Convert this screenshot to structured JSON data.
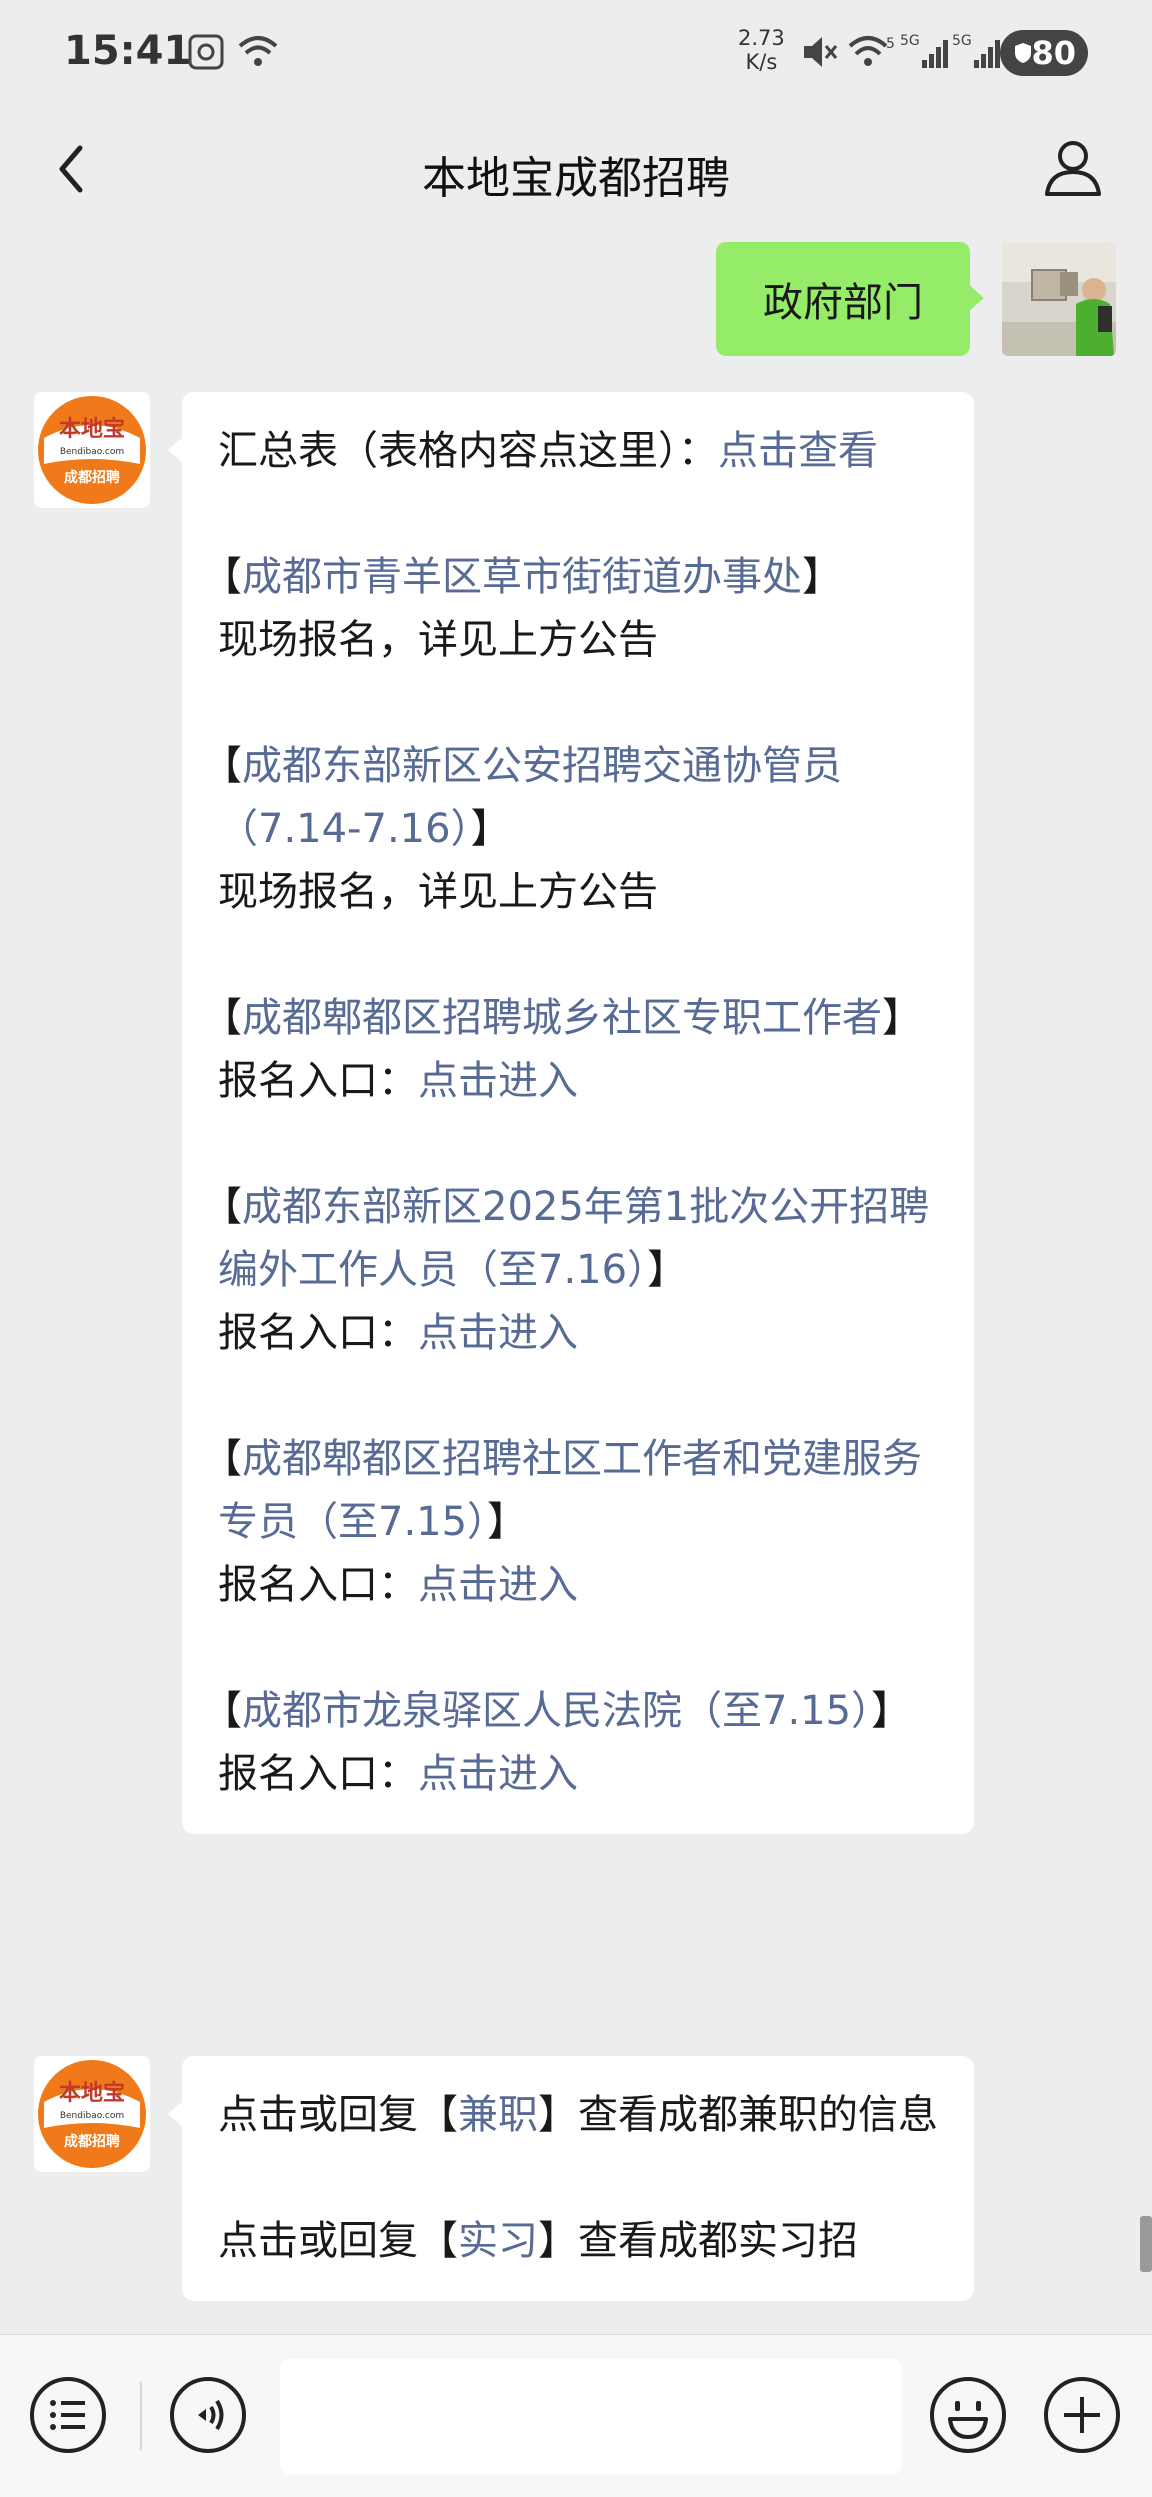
{
  "status_bar": {
    "time": "15:41",
    "net_speed_value": "2.73",
    "net_speed_unit": "K/s",
    "network_labels": [
      "5",
      "5G",
      "5G"
    ],
    "battery": "80"
  },
  "header": {
    "title": "本地宝成都招聘"
  },
  "user_message": {
    "text": "政府部门"
  },
  "bot_logo": {
    "brand": "本地宝",
    "domain": "Bendibao.com",
    "subtitle": "成都招聘"
  },
  "message1": {
    "summary_prefix": "汇总表（表格内容点这里）：",
    "summary_link": "点击查看",
    "items": [
      {
        "title": "成都市青羊区草市街街道办事处",
        "open": "【",
        "close": "】",
        "action_label": "现场报名，详见上方公告",
        "action_link": ""
      },
      {
        "title": "成都东部新区公安招聘交通协管员（7.14-7.16）",
        "open": "【",
        "close": "】",
        "action_label": "现场报名，详见上方公告",
        "action_link": ""
      },
      {
        "title": "成都郫都区招聘城乡社区专职工作者",
        "open": "【",
        "close": "】",
        "action_label": "报名入口：",
        "action_link": "点击进入"
      },
      {
        "title": "成都东部新区2025年第1批次公开招聘编外工作人员（至7.16）",
        "open": "【",
        "close": "】",
        "action_label": "报名入口：",
        "action_link": "点击进入"
      },
      {
        "title": "成都郫都区招聘社区工作者和党建服务专员（至7.15）",
        "open": "【",
        "close": "】",
        "action_label": "报名入口：",
        "action_link": "点击进入"
      },
      {
        "title": "成都市龙泉驿区人民法院（至7.15）",
        "open": "【",
        "close": "】",
        "action_label": "报名入口：",
        "action_link": "点击进入"
      }
    ]
  },
  "message2": {
    "lines": [
      {
        "prefix": "点击或回复【",
        "keyword": "兼职",
        "suffix": "】查看成都兼职的信息"
      },
      {
        "prefix": "点击或回复【",
        "keyword": "实习",
        "suffix": "】查看成都实习招"
      }
    ]
  },
  "colors": {
    "link": "#576b95",
    "my_bubble": "#95ec69",
    "background": "#ededed",
    "logo_orange": "#f07a1a"
  },
  "icons": {
    "back": "chevron-left-icon",
    "profile": "person-icon",
    "menu": "list-menu-icon",
    "voice": "voice-icon",
    "emoji": "smiley-icon",
    "plus": "plus-icon"
  }
}
